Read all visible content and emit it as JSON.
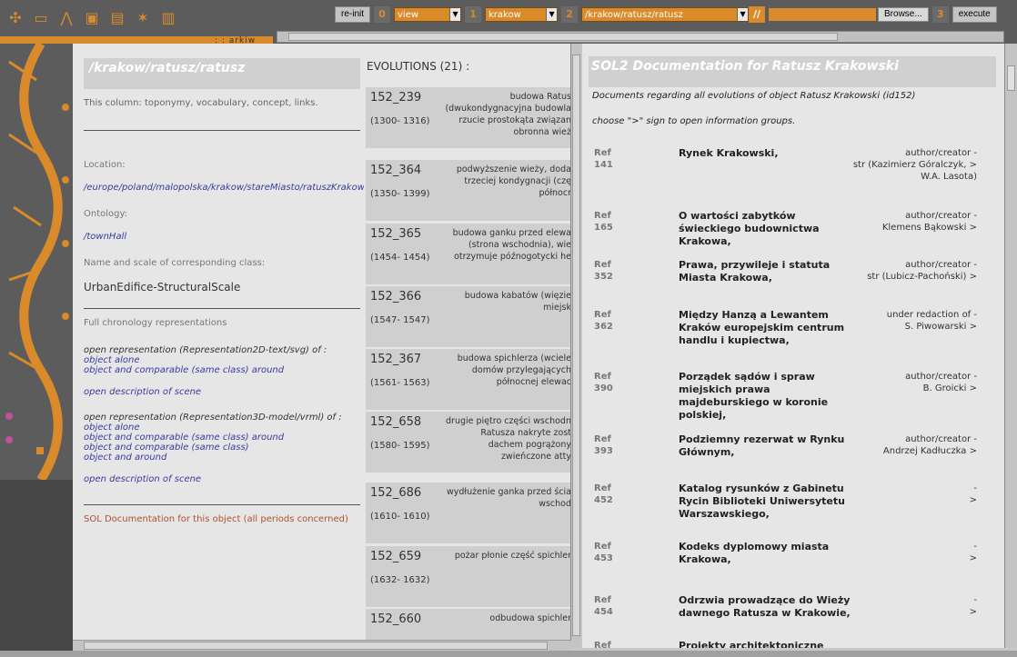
{
  "toolbar": {
    "reinit_label": "re-init",
    "step0": "0",
    "view_value": "view",
    "step1": "1",
    "place_value": "krakow",
    "step2": "2",
    "path_value": "/krakow/ratusz/ratusz",
    "slashes": "//",
    "browse_label": "Browse...",
    "step3": "3",
    "execute_label": "execute",
    "logo_text": ": : arkiw"
  },
  "col1": {
    "header": "/krakow/ratusz/ratusz",
    "intro": "This column: toponymy, vocabulary, concept, links.",
    "location_label": "Location:",
    "location_value": "/europe/poland/malopolska/krakow/stareMiasto/ratuszKrakowski",
    "ontology_label": "Ontology:",
    "ontology_value": "/townHall",
    "class_label": "Name and scale of corresponding class:",
    "class_value": "UrbanEdifice-StructuralScale",
    "chrono_label": "Full chronology representations",
    "rep2d_label": "open representation (Representation2D-text/svg) of :",
    "rep2d_links": [
      "object alone",
      "object and comparable (same class) around"
    ],
    "rep2d_scene": "open description of scene",
    "rep3d_label": "open representation (Representation3D-model/vrml) of :",
    "rep3d_links": [
      "object alone",
      "object and comparable (same class) around",
      "object and comparable (same class)",
      "object and around"
    ],
    "rep3d_scene": "open description of scene",
    "sol_link": "SOL Documentation for this object (all periods concerned)"
  },
  "col2": {
    "title": "EVOLUTIONS (21) :",
    "items": [
      {
        "id": "152_239",
        "years": "(1300- 1316)",
        "desc": [
          "budowa Ratus",
          "(dwukondygnacyjna budowla",
          "rzucie prostokąta związan",
          "obronna wież"
        ]
      },
      {
        "id": "152_364",
        "years": "(1350- 1399)",
        "desc": [
          "podwyższenie wieży, doda",
          "trzeciej kondygnacji (czę",
          "północr"
        ]
      },
      {
        "id": "152_365",
        "years": "(1454- 1454)",
        "desc": [
          "budowa ganku przed elewa",
          "(strona wschodnia), wie",
          "otrzymuje późnogotycki he"
        ]
      },
      {
        "id": "152_366",
        "years": "(1547- 1547)",
        "desc": [
          "budowa kabatów (więzie",
          "miejsk"
        ]
      },
      {
        "id": "152_367",
        "years": "(1561- 1563)",
        "desc": [
          "budowa spichlerza (wciele",
          "domów przylegających",
          "północnej elewac"
        ]
      },
      {
        "id": "152_658",
        "years": "(1580- 1595)",
        "desc": [
          "drugie piętro części wschodn",
          "Ratusza nakryte zost",
          "dachem pogrążony",
          "zwieńczone atty"
        ]
      },
      {
        "id": "152_686",
        "years": "(1610- 1610)",
        "desc": [
          "wydłużenie ganka przed ścia",
          "wschod"
        ]
      },
      {
        "id": "152_659",
        "years": "(1632- 1632)",
        "desc": [
          "pożar płonie część spichler"
        ]
      },
      {
        "id": "152_660",
        "years": "",
        "desc": [
          "odbudowa spichler"
        ]
      }
    ]
  },
  "col3": {
    "header": "SOL2 Documentation for Ratusz Krakowski",
    "intro1": "Documents regarding all evolutions of object Ratusz Krakowski (id152)",
    "intro2": "choose \">\" sign to open information groups.",
    "refs": [
      {
        "ref": "Ref",
        "num": "141",
        "title": "Rynek Krakowski,",
        "author": [
          "author/creator -",
          "str (Kazimierz Góralczyk, >",
          "W.A. Lasota)"
        ]
      },
      {
        "ref": "Ref",
        "num": "165",
        "title": "O wartości zabytków świeckiego budownictwa Krakowa,",
        "author": [
          "author/creator -",
          "Klemens Bąkowski >"
        ]
      },
      {
        "ref": "Ref",
        "num": "352",
        "title": "Prawa, przywileje i statuta Miasta Krakowa,",
        "author": [
          "author/creator -",
          "str (Lubicz-Pachoński) >"
        ]
      },
      {
        "ref": "Ref",
        "num": "362",
        "title": "Między Hanzą a Lewantem Kraków europejskim centrum handlu i kupiectwa,",
        "author": [
          "under redaction of -",
          "S. Piwowarski >"
        ]
      },
      {
        "ref": "Ref",
        "num": "390",
        "title": "Porządek sądów i spraw miejskich prawa majdeburskiego w koronie polskiej,",
        "author": [
          "author/creator -",
          "B. Groicki >"
        ]
      },
      {
        "ref": "Ref",
        "num": "393",
        "title": "Podziemny rezerwat w Rynku Głównym,",
        "author": [
          "author/creator -",
          "Andrzej Kadłuczka >"
        ]
      },
      {
        "ref": "Ref",
        "num": "452",
        "title": "Katalog rysunków z Gabinetu Rycin Biblioteki Uniwersytetu Warszawskiego,",
        "author": [
          "-",
          ">"
        ]
      },
      {
        "ref": "Ref",
        "num": "453",
        "title": "Kodeks dyplomowy miasta Krakowa,",
        "author": [
          "-",
          ">"
        ]
      },
      {
        "ref": "Ref",
        "num": "454",
        "title": "Odrzwia prowadzące do Wieży dawnego Ratusza w Krakowie,",
        "author": [
          "-",
          ">"
        ]
      },
      {
        "ref": "Ref",
        "num": "",
        "title": "Projekty architektoniczne",
        "author": []
      }
    ]
  }
}
